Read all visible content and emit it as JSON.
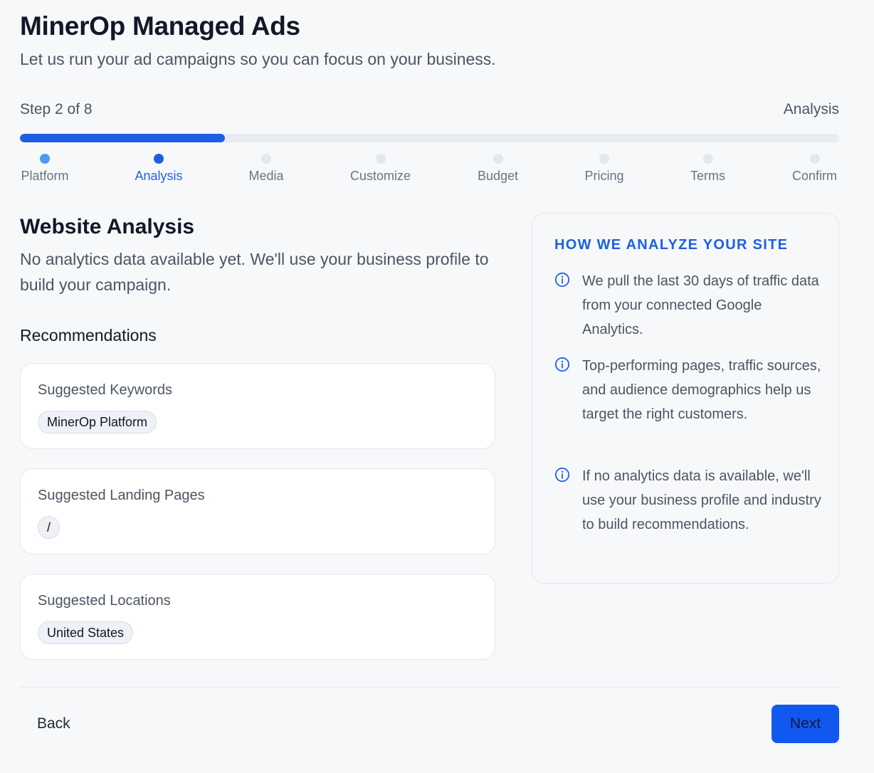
{
  "header": {
    "title": "MinerOp Managed Ads",
    "subtitle": "Let us run your ad campaigns so you can focus on your business."
  },
  "progress": {
    "step_text": "Step 2 of 8",
    "current_step_name": "Analysis",
    "fraction_complete": 0.25,
    "steps": [
      {
        "label": "Platform",
        "state": "done"
      },
      {
        "label": "Analysis",
        "state": "active"
      },
      {
        "label": "Media",
        "state": "pending"
      },
      {
        "label": "Customize",
        "state": "pending"
      },
      {
        "label": "Budget",
        "state": "pending"
      },
      {
        "label": "Pricing",
        "state": "pending"
      },
      {
        "label": "Terms",
        "state": "pending"
      },
      {
        "label": "Confirm",
        "state": "pending"
      }
    ]
  },
  "analysis": {
    "title": "Website Analysis",
    "description": "No analytics data available yet. We'll use your business profile to build your campaign.",
    "recommendations_heading": "Recommendations",
    "cards": [
      {
        "label": "Suggested Keywords",
        "chips": [
          "MinerOp Platform"
        ]
      },
      {
        "label": "Suggested Landing Pages",
        "chips": [
          "/"
        ]
      },
      {
        "label": "Suggested Locations",
        "chips": [
          "United States"
        ]
      }
    ]
  },
  "info_panel": {
    "heading": "HOW WE ANALYZE YOUR SITE",
    "icon": "info-circle-icon",
    "items": [
      "We pull the last 30 days of traffic data from your connected Google Analytics.",
      "Top-performing pages, traffic sources, and audience demographics help us target the right customers.",
      "If no analytics data is available, we'll use your business profile and industry to build recommendations."
    ]
  },
  "footer": {
    "back_label": "Back",
    "next_label": "Next"
  },
  "colors": {
    "accent": "#1d5fe0",
    "next_button": "#1158f0",
    "done_dot": "#4a9cf0",
    "pending_dot": "#e3e7ee"
  }
}
